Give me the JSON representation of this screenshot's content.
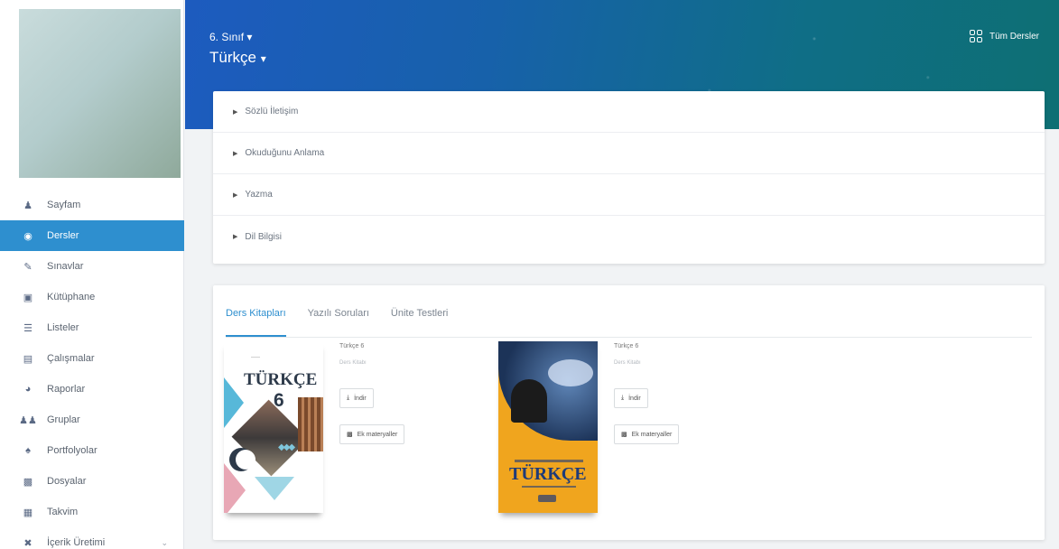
{
  "sidebar": {
    "items": [
      {
        "label": "Sayfam",
        "icon": "user-icon",
        "active": false
      },
      {
        "label": "Dersler",
        "icon": "circle-dot-icon",
        "active": true
      },
      {
        "label": "Sınavlar",
        "icon": "pencil-icon",
        "active": false
      },
      {
        "label": "Kütüphane",
        "icon": "book-icon",
        "active": false
      },
      {
        "label": "Listeler",
        "icon": "list-icon",
        "active": false
      },
      {
        "label": "Çalışmalar",
        "icon": "tasks-icon",
        "active": false
      },
      {
        "label": "Raporlar",
        "icon": "chart-icon",
        "active": false
      },
      {
        "label": "Gruplar",
        "icon": "users-icon",
        "active": false
      },
      {
        "label": "Portfolyolar",
        "icon": "portfolio-icon",
        "active": false
      },
      {
        "label": "Dosyalar",
        "icon": "folder-icon",
        "active": false
      },
      {
        "label": "Takvim",
        "icon": "calendar-icon",
        "active": false
      },
      {
        "label": "İçerik Üretimi",
        "icon": "puzzle-icon",
        "active": false,
        "has_caret": true
      }
    ]
  },
  "header": {
    "grade": "6. Sınıf",
    "subject": "Türkçe",
    "all_courses": "Tüm Dersler"
  },
  "topics": [
    "Sözlü İletişim",
    "Okuduğunu Anlama",
    "Yazma",
    "Dil Bilgisi"
  ],
  "tabs": [
    {
      "label": "Ders Kitapları",
      "active": true
    },
    {
      "label": "Yazılı Soruları",
      "active": false
    },
    {
      "label": "Ünite Testleri",
      "active": false
    }
  ],
  "books": [
    {
      "name": "Türkçe 6",
      "type": "Ders Kitabı",
      "cover_title": "TÜRKÇE",
      "cover_number": "6",
      "download_label": "İndir",
      "extra_label": "Ek materyaller"
    },
    {
      "name": "Türkçe 6",
      "type": "Ders Kitabı",
      "cover_title": "TÜRKÇE",
      "download_label": "İndir",
      "extra_label": "Ek materyaller"
    }
  ],
  "colors": {
    "accent": "#2e8fcf",
    "header_start": "#1d5bbf",
    "header_end": "#0e6f73"
  }
}
